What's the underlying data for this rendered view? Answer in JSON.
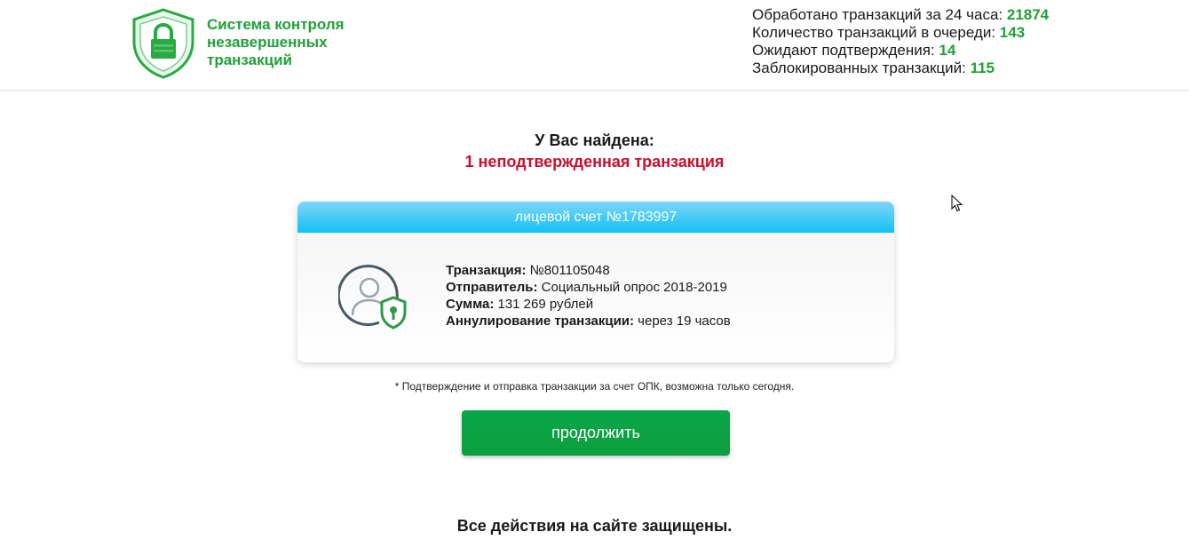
{
  "colors": {
    "brand_green": "#21a038",
    "alert_red": "#c8102e",
    "card_header_blue": "#10c1f5",
    "button_green": "#0aa64a"
  },
  "header": {
    "logo_icon": "shield-lock-icon",
    "logo_text": "Система контроля незавершенных транзакций",
    "stats": [
      {
        "label": "Обработано транзакций за 24 часа:",
        "value": "21874"
      },
      {
        "label": "Количество транзакций в очереди:",
        "value": "143"
      },
      {
        "label": "Ожидают подтверждения:",
        "value": "14"
      },
      {
        "label": "Заблокированных транзакций:",
        "value": "115"
      }
    ]
  },
  "found": {
    "line1": "У Вас найдена:",
    "line2": "1 неподтвержденная транзакция"
  },
  "card": {
    "header": "лицевой счет №1783997",
    "icon": "user-shield-icon",
    "rows": [
      {
        "label": "Транзакция:",
        "value": " №801105048"
      },
      {
        "label": "Отправитель:",
        "value": " Социальный опрос 2018-2019"
      },
      {
        "label": "Сумма:",
        "value": " 131 269 рублей"
      },
      {
        "label": "Аннулирование транзакции:",
        "value": " через 19 часов"
      }
    ]
  },
  "note": "* Подтверждение и отправка транзакции за счет ОПК, возможна только сегодня.",
  "button": {
    "label": "продолжить"
  },
  "footer": "Все действия на сайте защищены."
}
